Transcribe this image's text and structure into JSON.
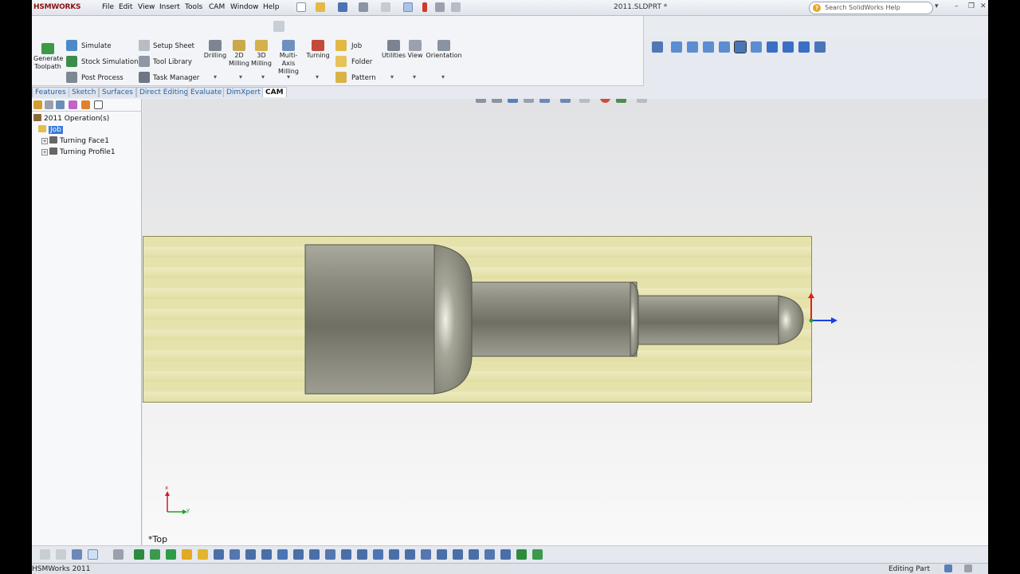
{
  "app": {
    "logo": "HSMWORKS",
    "document_title": "2011.SLDPRT *"
  },
  "menu": [
    "File",
    "Edit",
    "View",
    "Insert",
    "Tools",
    "CAM",
    "Window",
    "Help"
  ],
  "search": {
    "placeholder": "Search SolidWorks Help"
  },
  "ribbon": {
    "generate_toolpath": "Generate Toolpath",
    "simulate": "Simulate",
    "stock_simulation": "Stock Simulation",
    "post_process": "Post Process",
    "setup_sheet": "Setup Sheet",
    "tool_library": "Tool Library",
    "task_manager": "Task Manager",
    "drilling": "Drilling",
    "milling_2d": "2D Milling",
    "milling_3d": "3D Milling",
    "multi_axis": "Multi-Axis Milling",
    "turning": "Turning",
    "job": "Job",
    "folder": "Folder",
    "pattern": "Pattern",
    "utilities": "Utilities",
    "view": "View",
    "orientation": "Orientation"
  },
  "tabs": [
    "Features",
    "Sketch",
    "Surfaces",
    "Direct Editing",
    "Evaluate",
    "DimXpert",
    "CAM"
  ],
  "active_tab": "CAM",
  "tree": {
    "root": "2011 Operation(s)",
    "job": "Job",
    "ops": [
      "Turning Face1",
      "Turning Profile1"
    ]
  },
  "viewport": {
    "view_name": "*Top",
    "triad_x": "x",
    "triad_y": "y"
  },
  "status": {
    "left": "HSMWorks 2011",
    "right": "Editing Part"
  },
  "colors": {
    "stock": "#e5e2ac",
    "part": "#8a8a7e",
    "selection": "#3b79d6",
    "accent_red": "#c62121"
  }
}
